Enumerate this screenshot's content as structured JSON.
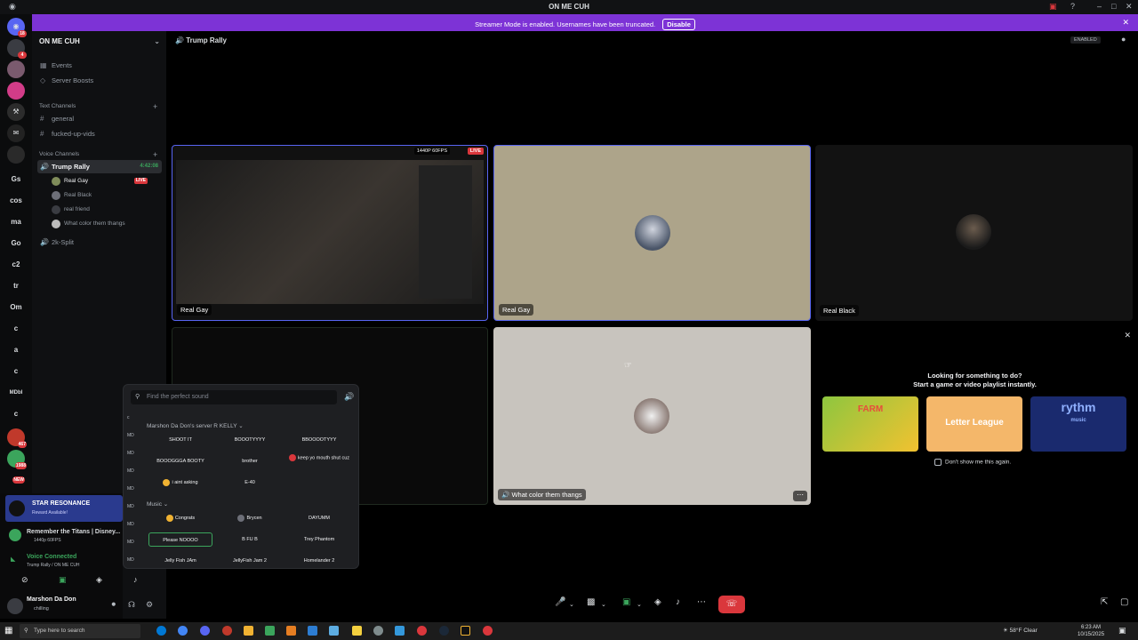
{
  "window": {
    "title": "ON ME CUH"
  },
  "banner": {
    "text": "Streamer Mode is enabled. Usernames have been truncated.",
    "disable_label": "Disable"
  },
  "rail": {
    "items": [
      "Gs",
      "cos",
      "ma",
      "Go",
      "c2",
      "tr",
      "Om",
      "c",
      "a",
      "c",
      "MDbI",
      "c"
    ],
    "badges": [
      "18",
      "4",
      "467",
      "1988",
      "NEW"
    ]
  },
  "sidebar": {
    "server_name": "ON ME CUH",
    "events": "Events",
    "boosts": "Server Boosts",
    "text_category": "Text Channels",
    "text_channels": [
      "general",
      "fucked-up-vids"
    ],
    "voice_category": "Voice Channels",
    "voice_channel": "Trump Rally",
    "voice_time": "4:42:08",
    "voice_users": [
      {
        "name": "Real Gay",
        "live": "LIVE"
      },
      {
        "name": "Real Black"
      },
      {
        "name": "real friend"
      },
      {
        "name": "What color them thangs"
      }
    ],
    "other_voice": "2k-Split"
  },
  "main": {
    "voice_header": "Trump Rally",
    "enabled_badge": "ENABLED",
    "stream_badge": "1440P 60FPS",
    "live_badge": "LIVE",
    "tiles": [
      "Real Gay",
      "Real Gay",
      "Real Black",
      "What color them thangs"
    ]
  },
  "sound_panel": {
    "placeholder": "Find the perfect sound",
    "section1": "Marshon Da Don's server R KELLY",
    "row1": [
      "SHOOT IT",
      "BOOOTYYYY",
      "BBOOOOTYYY"
    ],
    "row2": [
      "BOOOGGGA BOOTY",
      "brother",
      "keep yo mouth shut cuz"
    ],
    "row3": [
      "i aint asking",
      "E-40"
    ],
    "section2": "Music",
    "row4": [
      "Congrats",
      "Brycen",
      "DAYUMM"
    ],
    "row5": [
      "Please NOOOO",
      "B FU B",
      "Trey Phantom"
    ],
    "row6": [
      "Jelly Fish JAm",
      "JellyFish Jam 2",
      "Homelander 2"
    ],
    "side": [
      "c",
      "MD",
      "MD",
      "MD",
      "MD",
      "MD",
      "MD",
      "MD",
      "MD"
    ]
  },
  "activities": {
    "heading1": "Looking for something to do?",
    "heading2": "Start a game or video playlist instantly.",
    "cards": [
      "FARM",
      "Letter League",
      "rythm"
    ],
    "card_sub": "music",
    "dont_show": "Don't show me this again."
  },
  "user_panel": {
    "promo_title": "STAR RESONANCE",
    "promo_sub": "Reward Available!",
    "activity": "Remember the Titans | Disney...",
    "activity_sub": "1440p 60FPS",
    "voice_connected": "Voice Connected",
    "voice_location": "Trump Rally / ON ME CUH",
    "username": "Marshon Da Don",
    "status": "chilling"
  },
  "taskbar": {
    "search": "Type here to search",
    "weather": "58°F  Clear",
    "time": "6:23 AM",
    "date": "10/15/2025"
  },
  "colors": {
    "accent": "#7d33d6",
    "live": "#da373c",
    "green": "#3ba55c",
    "end_call": "#da373c"
  }
}
